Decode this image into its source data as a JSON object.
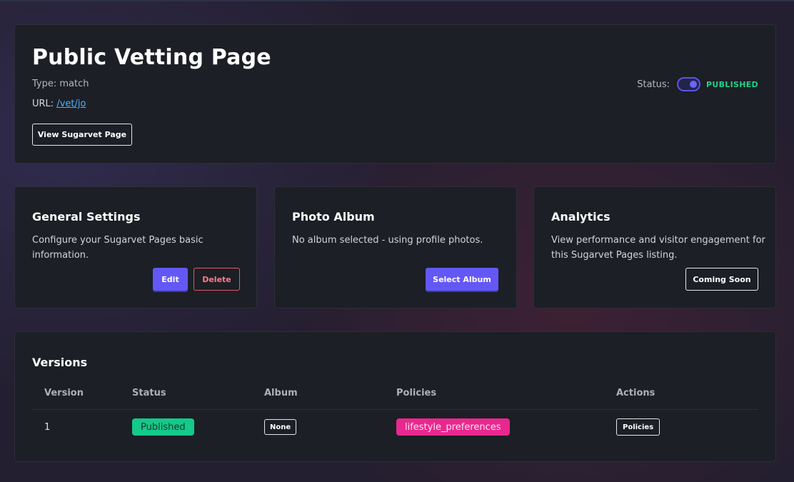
{
  "header": {
    "title": "Public Vetting Page",
    "type_line": "Type: match",
    "url_label": "URL:",
    "url_value": "/vet/jo",
    "view_button": "View Sugarvet Page",
    "status_label": "Status:",
    "status_value": "PUBLISHED",
    "status_on": true
  },
  "cards": {
    "general": {
      "title": "General Settings",
      "description": "Configure your Sugarvet Pages basic information.",
      "edit_label": "Edit",
      "delete_label": "Delete"
    },
    "album": {
      "title": "Photo Album",
      "description": "No album selected - using profile photos.",
      "select_label": "Select Album"
    },
    "analytics": {
      "title": "Analytics",
      "description": "View performance and visitor engagement for this Sugarvet Pages listing.",
      "soon_label": "Coming Soon"
    }
  },
  "versions": {
    "title": "Versions",
    "columns": [
      "Version",
      "Status",
      "Album",
      "Policies",
      "Actions"
    ],
    "rows": [
      {
        "version": "1",
        "status": "Published",
        "album": "None",
        "policy": "lifestyle_preferences",
        "action": "Policies"
      }
    ]
  },
  "colors": {
    "accent": "#6358f5",
    "published_green": "#14c98a",
    "policy_pink": "#e8288e",
    "danger": "#e05a6a",
    "link": "#4db2ff"
  }
}
